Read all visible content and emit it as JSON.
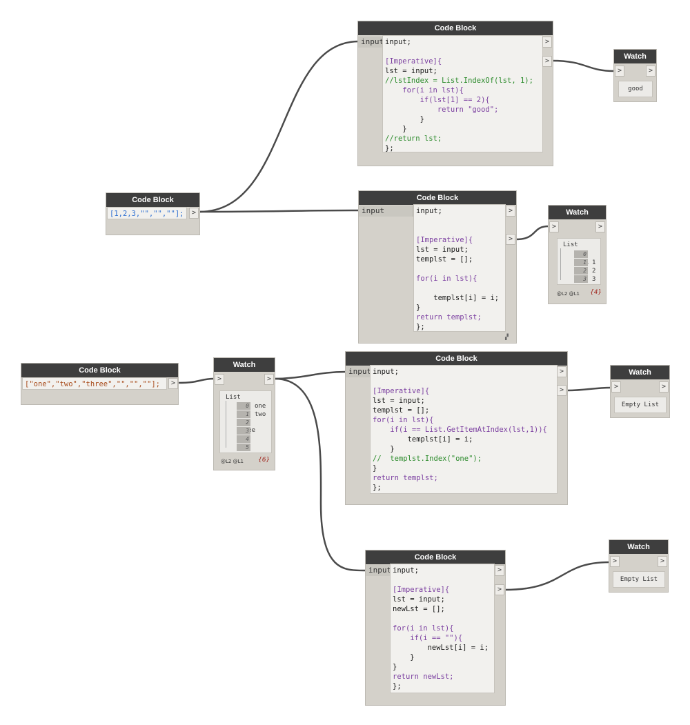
{
  "node_titles": {
    "code_block": "Code Block",
    "watch": "Watch"
  },
  "ports": {
    "input": "input",
    "arrow": ">"
  },
  "list_title": "List",
  "levels_label": "@L2 @L1",
  "top_code_block": {
    "lines": [
      "input;",
      "",
      "[Imperative]{",
      "lst = input;",
      "//lstIndex = List.IndexOf(lst, 1);",
      "    for(i in lst){",
      "        if(lst[1] == 2){",
      "            return \"good\";",
      "        }",
      "    }",
      "//return lst;",
      "};"
    ]
  },
  "top_watch": {
    "value": "good"
  },
  "numbers_code_block": {
    "code": "[1,2,3,\"\",\"\",\"\"];"
  },
  "second_code_block": {
    "lines": [
      "input;",
      "",
      "",
      "[Imperative]{",
      "lst = input;",
      "templst = [];",
      "",
      "for(i in lst){",
      "",
      "    templst[i] = i;",
      "}",
      "return templst;",
      "};"
    ]
  },
  "second_watch": {
    "items": [
      {
        "index": "0",
        "value": "null"
      },
      {
        "index": "1",
        "value": "1"
      },
      {
        "index": "2",
        "value": "2"
      },
      {
        "index": "3",
        "value": "3"
      }
    ],
    "count": "{4}"
  },
  "strings_code_block": {
    "code": "[\"one\",\"two\",\"three\",\"\",\"\",\"\"];"
  },
  "middle_watch": {
    "items": [
      {
        "index": "0",
        "value": "one"
      },
      {
        "index": "1",
        "value": "two"
      },
      {
        "index": "2",
        "value": "three"
      },
      {
        "index": "3",
        "value": ""
      },
      {
        "index": "4",
        "value": ""
      },
      {
        "index": "5",
        "value": ""
      }
    ],
    "count": "{6}"
  },
  "third_code_block": {
    "lines": [
      "input;",
      "",
      "[Imperative]{",
      "lst = input;",
      "templst = [];",
      "for(i in lst){",
      "    if(i == List.GetItemAtIndex(lst,1)){",
      "        templst[i] = i;",
      "    }",
      "//  templst.Index(\"one\");",
      "}",
      "return templst;",
      "};"
    ]
  },
  "third_watch": {
    "value": "Empty List"
  },
  "fourth_code_block": {
    "lines": [
      "input;",
      "",
      "[Imperative]{",
      "lst = input;",
      "newLst = [];",
      "",
      "for(i in lst){",
      "    if(i == \"\"){",
      "        newLst[i] = i;",
      "    }",
      "}",
      "return newLst;",
      "};"
    ]
  },
  "fourth_watch": {
    "value": "Empty List"
  },
  "colors": {
    "header": "#3e3e3e",
    "node_body": "#d4d1ca",
    "wire": "#4a4a4a",
    "keyword": "#7b3fa0",
    "comment": "#2a8a2a",
    "number": "#2d6fd1",
    "string": "#a84c1c"
  }
}
